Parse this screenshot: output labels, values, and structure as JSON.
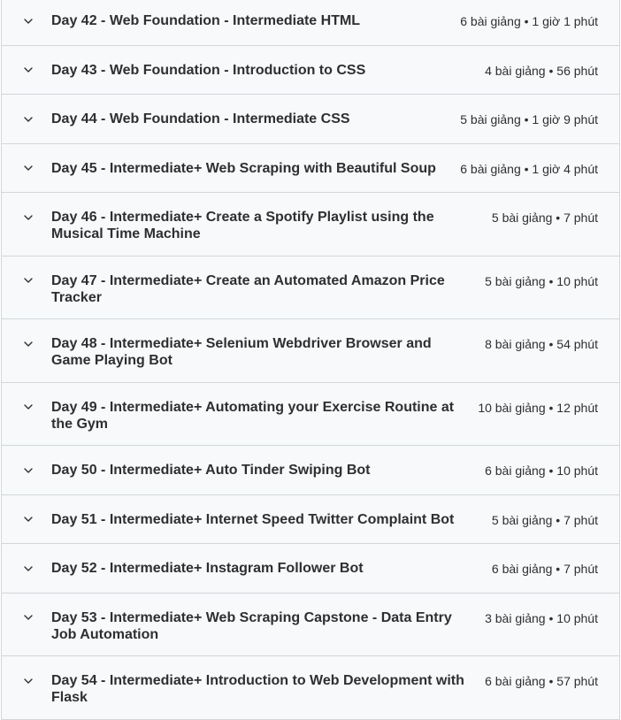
{
  "sections": [
    {
      "title": "Day 42 - Web Foundation - Intermediate HTML",
      "meta": "6 bài giảng • 1 giờ 1 phút",
      "lines": 1
    },
    {
      "title": "Day 43 - Web Foundation - Introduction to CSS",
      "meta": "4 bài giảng • 56 phút",
      "lines": 1
    },
    {
      "title": "Day 44 - Web Foundation - Intermediate CSS",
      "meta": "5 bài giảng • 1 giờ 9 phút",
      "lines": 1
    },
    {
      "title": "Day 45 - Intermediate+ Web Scraping with Beautiful Soup",
      "meta": "6 bài giảng • 1 giờ 4 phút",
      "lines": 1
    },
    {
      "title": "Day 46 - Intermediate+ Create a Spotify Playlist using the Musical Time Machine",
      "meta": "5 bài giảng • 7 phút",
      "lines": 2
    },
    {
      "title": "Day 47 - Intermediate+ Create an Automated Amazon Price Tracker",
      "meta": "5 bài giảng • 10 phút",
      "lines": 2
    },
    {
      "title": "Day 48 - Intermediate+ Selenium Webdriver Browser and Game Playing Bot",
      "meta": "8 bài giảng • 54 phút",
      "lines": 2
    },
    {
      "title": "Day 49 - Intermediate+ Automating your Exercise Routine at the Gym",
      "meta": "10 bài giảng • 12 phút",
      "lines": 2
    },
    {
      "title": "Day 50 - Intermediate+ Auto Tinder Swiping Bot",
      "meta": "6 bài giảng • 10 phút",
      "lines": 1
    },
    {
      "title": "Day 51 - Intermediate+ Internet Speed Twitter Complaint Bot",
      "meta": "5 bài giảng • 7 phút",
      "lines": 1
    },
    {
      "title": "Day 52 - Intermediate+ Instagram Follower Bot",
      "meta": "6 bài giảng • 7 phút",
      "lines": 1
    },
    {
      "title": "Day 53 - Intermediate+ Web Scraping Capstone - Data Entry Job Automation",
      "meta": "3 bài giảng • 10 phút",
      "lines": 2
    },
    {
      "title": "Day 54 - Intermediate+ Introduction to Web Development with Flask",
      "meta": "6 bài giảng • 57 phút",
      "lines": 2
    }
  ],
  "icons": {
    "expand": "chevron-down-icon"
  },
  "colors": {
    "background": "#f7f9fa",
    "border": "#d1d7dc",
    "text": "#2d2f31"
  }
}
